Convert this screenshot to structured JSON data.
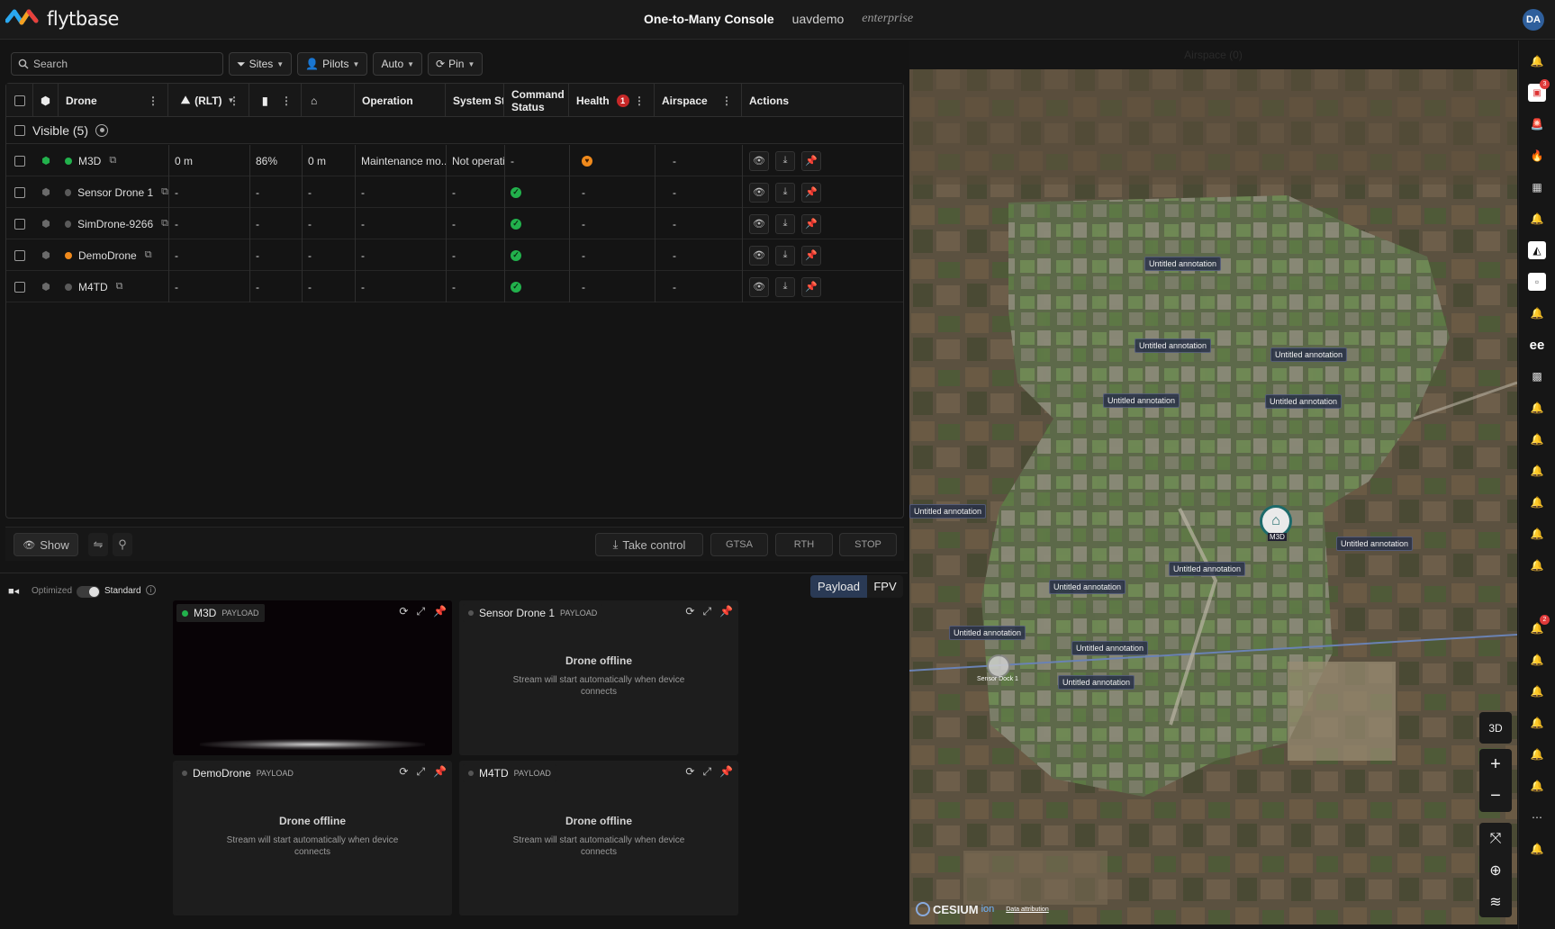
{
  "header": {
    "brand": "flytbase",
    "console_title": "One-to-Many Console",
    "org": "uavdemo",
    "plan": "enterprise",
    "avatar": "DA"
  },
  "filters": {
    "search_placeholder": "Search",
    "sites": "Sites",
    "pilots": "Pilots",
    "auto": "Auto",
    "pin": "Pin"
  },
  "table": {
    "columns": {
      "drone": "Drone",
      "altitude": "(RLT)",
      "operation": "Operation",
      "system_status": "System Stat",
      "command_status": "Command Status",
      "health": "Health",
      "health_badge": "1",
      "airspace": "Airspace",
      "actions": "Actions"
    },
    "group_label": "Visible (5)",
    "rows": [
      {
        "name": "M3D",
        "status_color": "#22b14c",
        "alt": "0 m",
        "battery": "86%",
        "home": "0 m",
        "operation": "Maintenance mo...",
        "system": "Not operatio",
        "command": "-",
        "health": "warn",
        "airspace": "-"
      },
      {
        "name": "Sensor Drone 1",
        "status_color": "#5a5a5a",
        "alt": "-",
        "battery": "-",
        "home": "-",
        "operation": "-",
        "system": "-",
        "command": "ok",
        "health": "-",
        "airspace": "-"
      },
      {
        "name": "SimDrone-9266",
        "status_color": "#5a5a5a",
        "alt": "-",
        "battery": "-",
        "home": "-",
        "operation": "-",
        "system": "-",
        "command": "ok",
        "health": "-",
        "airspace": "-"
      },
      {
        "name": "DemoDrone",
        "status_color": "#f08a1c",
        "alt": "-",
        "battery": "-",
        "home": "-",
        "operation": "-",
        "system": "-",
        "command": "ok",
        "health": "-",
        "airspace": "-"
      },
      {
        "name": "M4TD",
        "status_color": "#5a5a5a",
        "alt": "-",
        "battery": "-",
        "home": "-",
        "operation": "-",
        "system": "-",
        "command": "ok",
        "health": "-",
        "airspace": "-"
      }
    ]
  },
  "actionbar": {
    "show": "Show",
    "take_control": "Take control",
    "gtsa": "GTSA",
    "rth": "RTH",
    "stop": "STOP"
  },
  "video": {
    "optimized": "Optimized",
    "standard": "Standard",
    "tab_payload": "Payload",
    "tab_fpv": "FPV",
    "payload_tag": "PAYLOAD",
    "offline_title": "Drone offline",
    "offline_sub": "Stream will start automatically when device connects",
    "feeds": [
      "M3D",
      "Sensor Drone 1",
      "DemoDrone",
      "M4TD"
    ]
  },
  "map": {
    "airspace_label": "Airspace (0)",
    "annotation": "Untitled annotation",
    "dock_label": "Sensor Dock 1",
    "drone_label": "M3D",
    "btn_3d": "3D",
    "zoom_in": "+",
    "zoom_out": "−",
    "cesium": "CESIUM",
    "ion": "ion",
    "attribution": "Data attribution"
  },
  "rail": {
    "badge_top": "3",
    "badge_lower": "2"
  }
}
